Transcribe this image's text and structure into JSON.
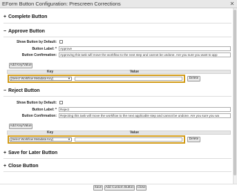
{
  "window": {
    "title": "EForm Button Configuration: Prescreen Corrections",
    "close_glyph": "✕"
  },
  "sections": {
    "complete": {
      "toggle": "+",
      "title": "Complete Button"
    },
    "approve": {
      "toggle": "−",
      "title": "Approve Button",
      "show_default_label": "Show Button by Default:",
      "button_label_label": "Button Label: *",
      "button_label_value": "Approve",
      "confirmation_label": "Button Confirmation:",
      "confirmation_value": "Approving this task will move the workflow to the next step and cannot be undone. Are you sure you want to app",
      "add_key_value": "Add Key/Value",
      "key_header": "Key",
      "value_header": "Value",
      "select_value": "[Select Workflow Metadata Key]",
      "delete": "Delete"
    },
    "reject": {
      "toggle": "−",
      "title": "Reject Button",
      "show_default_label": "Show Button by Default:",
      "button_label_label": "Button Label: *",
      "button_label_value": "Reject",
      "confirmation_label": "Button Confirmation:",
      "confirmation_value": "Rejecting this task will move the workflow to the next applicable step and cannot be undone. Are you sure you wa",
      "add_key_value": "Add Key/Value",
      "key_header": "Key",
      "value_header": "Value",
      "select_value": "[Select Workflow Metadata Key]",
      "delete": "Delete"
    },
    "save_later": {
      "toggle": "+",
      "title": "Save for Later Button"
    },
    "close": {
      "toggle": "+",
      "title": "Close Button"
    }
  },
  "footer": {
    "save": "Save",
    "add_custom": "Add Custom Button",
    "close": "Close"
  },
  "icons": {
    "select_arrow": "▼"
  },
  "colors": {
    "highlight": "#d19a15"
  }
}
